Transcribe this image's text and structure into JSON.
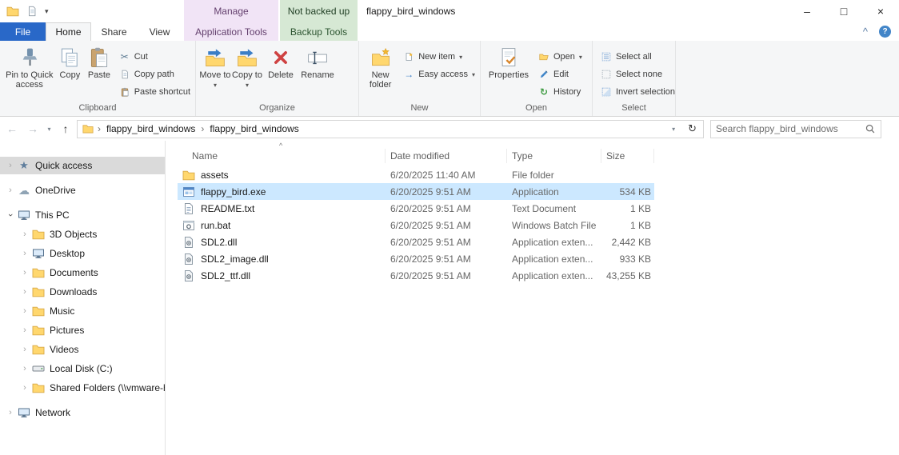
{
  "window": {
    "title": "flappy_bird_windows",
    "controls": {
      "minimize": "–",
      "maximize": "□",
      "close": "×"
    }
  },
  "contextual": {
    "manage": {
      "header": "Manage",
      "tab": "Application Tools"
    },
    "backup": {
      "header": "Not backed up",
      "tab": "Backup Tools"
    }
  },
  "ribbon": {
    "file_tab": "File",
    "tabs": [
      {
        "label": "Home",
        "active": true
      },
      {
        "label": "Share"
      },
      {
        "label": "View"
      }
    ],
    "buttons": {
      "pin": "Pin to Quick access",
      "copy": "Copy",
      "paste": "Paste",
      "cut": "Cut",
      "copy_path": "Copy path",
      "paste_shortcut": "Paste shortcut",
      "move_to": "Move to",
      "copy_to": "Copy to",
      "delete": "Delete",
      "rename": "Rename",
      "new_folder": "New folder",
      "new_item": "New item",
      "easy_access": "Easy access",
      "properties": "Properties",
      "open": "Open",
      "edit": "Edit",
      "history": "History",
      "select_all": "Select all",
      "select_none": "Select none",
      "invert_selection": "Invert selection"
    },
    "group_labels": {
      "clipboard": "Clipboard",
      "organize": "Organize",
      "new": "New",
      "open": "Open",
      "select": "Select"
    }
  },
  "address": {
    "crumbs": [
      {
        "label": "flappy_bird_windows"
      },
      {
        "label": "flappy_bird_windows"
      }
    ],
    "search_placeholder": "Search flappy_bird_windows"
  },
  "sidebar": {
    "items": [
      {
        "label": "Quick access",
        "selected": true
      },
      {
        "label": "OneDrive"
      },
      {
        "label": "This PC",
        "expanded": true
      },
      {
        "label": "3D Objects"
      },
      {
        "label": "Desktop"
      },
      {
        "label": "Documents"
      },
      {
        "label": "Downloads"
      },
      {
        "label": "Music"
      },
      {
        "label": "Pictures"
      },
      {
        "label": "Videos"
      },
      {
        "label": "Local Disk (C:)"
      },
      {
        "label": "Shared Folders (\\\\vmware-ho"
      },
      {
        "label": "Network"
      }
    ]
  },
  "files": {
    "columns": [
      {
        "label": "Name"
      },
      {
        "label": "Date modified"
      },
      {
        "label": "Type"
      },
      {
        "label": "Size"
      }
    ],
    "rows": [
      {
        "name": "assets",
        "date": "6/20/2025 11:40 AM",
        "type": "File folder",
        "size": ""
      },
      {
        "name": "flappy_bird.exe",
        "date": "6/20/2025 9:51 AM",
        "type": "Application",
        "size": "534 KB",
        "selected": true
      },
      {
        "name": "README.txt",
        "date": "6/20/2025 9:51 AM",
        "type": "Text Document",
        "size": "1 KB"
      },
      {
        "name": "run.bat",
        "date": "6/20/2025 9:51 AM",
        "type": "Windows Batch File",
        "size": "1 KB"
      },
      {
        "name": "SDL2.dll",
        "date": "6/20/2025 9:51 AM",
        "type": "Application exten...",
        "size": "2,442 KB"
      },
      {
        "name": "SDL2_image.dll",
        "date": "6/20/2025 9:51 AM",
        "type": "Application exten...",
        "size": "933 KB"
      },
      {
        "name": "SDL2_ttf.dll",
        "date": "6/20/2025 9:51 AM",
        "type": "Application exten...",
        "size": "43,255 KB"
      }
    ]
  },
  "glyphs": {
    "caret_down": "▾",
    "breadcrumb_sep": "›",
    "chevron": "›",
    "sort_asc": "^",
    "back": "←",
    "forward": "→",
    "up": "↑",
    "refresh": "↻",
    "ribbon_collapse": "^",
    "help": "?",
    "star": "★",
    "cloud": "☁",
    "scissors": "✂",
    "arrow_right": "→",
    "history": "↻"
  },
  "colors": {
    "file_tab_blue": "#2968c8",
    "manage_header_bg": "#f1e4f6",
    "backup_header_bg": "#d6e8d4",
    "selection_blue": "#cce8ff",
    "sidebar_selected_gray": "#dadada",
    "folder_yellow": "#ffd76e"
  }
}
